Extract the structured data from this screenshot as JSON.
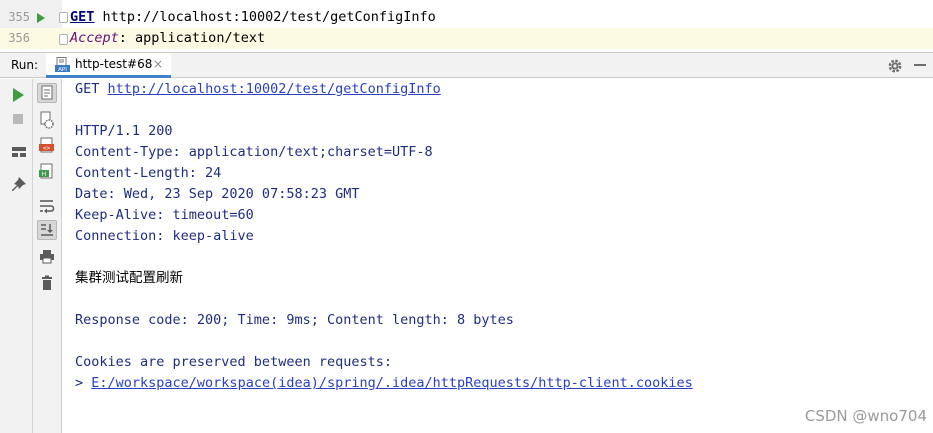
{
  "editor": {
    "lines": [
      {
        "number": "355",
        "method": "GET",
        "rest": " http://localhost:10002/test/getConfigInfo"
      },
      {
        "number": "356",
        "header_name": "Accept",
        "rest": ": application/text"
      }
    ]
  },
  "run_panel": {
    "label": "Run:",
    "tab": {
      "label": "http-test#68",
      "close": "×"
    }
  },
  "console": {
    "request": {
      "method": "GET",
      "url": "http://localhost:10002/test/getConfigInfo"
    },
    "status": "HTTP/1.1 200",
    "headers": [
      "Content-Type: application/text;charset=UTF-8",
      "Content-Length: 24",
      "Date: Wed, 23 Sep 2020 07:58:23 GMT",
      "Keep-Alive: timeout=60",
      "Connection: keep-alive"
    ],
    "body": "集群测试配置刷新",
    "summary": "Response code: 200; Time: 9ms; Content length: 8 bytes",
    "cookies_note": "Cookies are preserved between requests:",
    "cookies_prefix": "> ",
    "cookies_path": "E:/workspace/workspace(idea)/spring/.idea/httpRequests/http-client.cookies"
  },
  "watermark": "CSDN @wno704",
  "colors": {
    "run_green": "#3f9b3f",
    "tab_underline": "#4083c9",
    "console_text": "#1e2d80",
    "link": "#2a3fc2"
  }
}
